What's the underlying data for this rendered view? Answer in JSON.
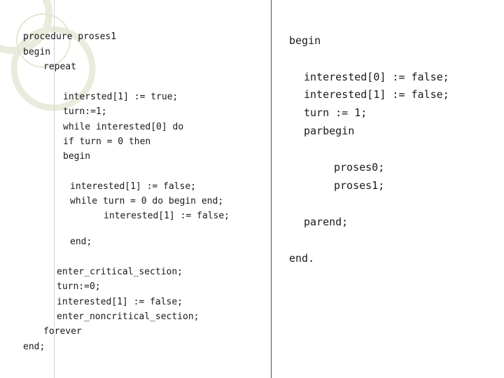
{
  "left_code": {
    "line01": "procedure proses1",
    "line02": "begin",
    "line03": "repeat",
    "line04": "intersted[1] := true;",
    "line05": "turn:=1;",
    "line06": "while interested[0] do",
    "line07": "if turn = 0 then",
    "line08": "begin",
    "line09": "interested[1] := false;",
    "line10": "while turn = 0 do begin end;",
    "line11": "interested[1] := false;",
    "line12": "end;",
    "line13": "enter_critical_section;",
    "line14": "turn:=0;",
    "line15": "interested[1] := false;",
    "line16": "enter_noncritical_section;",
    "line17": "forever",
    "line18": "end;"
  },
  "right_code": {
    "line01": "begin",
    "line02": "interested[0] := false;",
    "line03": "interested[1] := false;",
    "line04": "turn := 1;",
    "line05": "parbegin",
    "line06": "proses0;",
    "line07": "proses1;",
    "line08": "parend;",
    "line09": "end."
  }
}
